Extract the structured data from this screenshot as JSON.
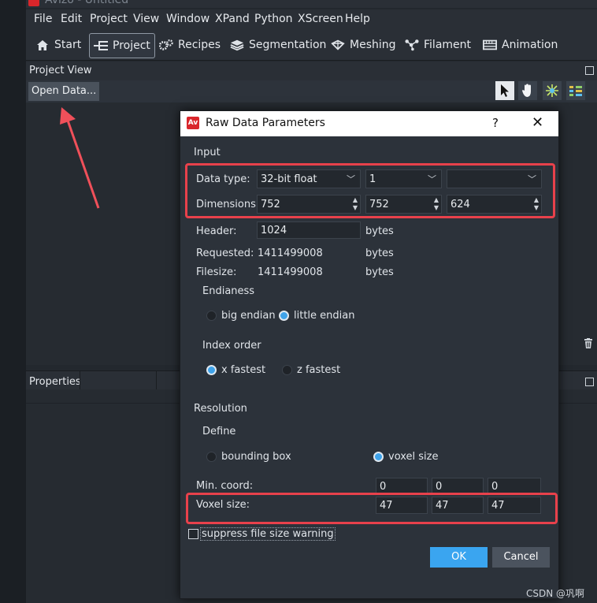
{
  "app": {
    "title": "Avizo - Untitled"
  },
  "menu": [
    "File",
    "Edit",
    "Project",
    "View",
    "Window",
    "XPand",
    "Python",
    "XScreen",
    "Help"
  ],
  "toolbar": {
    "start": "Start",
    "project": "Project",
    "recipes": "Recipes",
    "segmentation": "Segmentation",
    "meshing": "Meshing",
    "filament": "Filament",
    "animation": "Animation"
  },
  "project_view": {
    "title": "Project View",
    "open_data": "Open Data..."
  },
  "properties": {
    "title": "Properties"
  },
  "dialog": {
    "logo": "Av",
    "title": "Raw Data Parameters",
    "help": "?",
    "close": "✕",
    "input_section": "Input",
    "data_type_label": "Data type:",
    "data_type_value": "32-bit float",
    "components_value": "1",
    "third_combo_value": "",
    "dimensions_label": "Dimensions:",
    "dim_x": "752",
    "dim_y": "752",
    "dim_z": "624",
    "header_label": "Header:",
    "header_value": "1024",
    "header_unit": "bytes",
    "requested_label": "Requested:",
    "requested_value": "1411499008",
    "requested_unit": "bytes",
    "filesize_label": "Filesize:",
    "filesize_value": "1411499008",
    "filesize_unit": "bytes",
    "endianess_label": "Endianess",
    "big_endian": "big endian",
    "little_endian": "little endian",
    "index_order_label": "Index order",
    "x_fastest": "x fastest",
    "z_fastest": "z fastest",
    "resolution_label": "Resolution",
    "define_label": "Define",
    "bounding_box": "bounding box",
    "voxel_size_option": "voxel size",
    "min_coord_label": "Min. coord:",
    "min_x": "0",
    "min_y": "0",
    "min_z": "0",
    "voxel_size_label": "Voxel size:",
    "vox_x": "47",
    "vox_y": "47",
    "vox_z": "47",
    "suppress_label": "suppress file size warning",
    "ok": "OK",
    "cancel": "Cancel"
  },
  "watermark": "CSDN @巩啊",
  "colors": {
    "accent": "#3aa5f0",
    "highlight": "#e8414b",
    "logo": "#d9262b"
  }
}
